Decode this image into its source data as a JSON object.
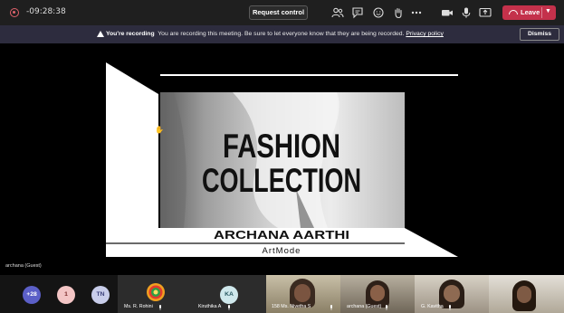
{
  "topbar": {
    "timer": "-09:28:38",
    "request_control": "Request control",
    "leave": "Leave"
  },
  "banner": {
    "bold": "You're recording",
    "text": "You are recording this meeting. Be sure to let everyone know that they are being recorded.",
    "link": "Privacy policy",
    "dismiss": "Dismiss"
  },
  "slide": {
    "title_line1": "FASHION",
    "title_line2": "COLLECTION",
    "name": "ARCHANA AARTHI",
    "brand": "ArtMode"
  },
  "presenter_caption": "archana (Guest)",
  "participants": {
    "more_count": "+28",
    "badge_1": "1",
    "tn": "TN",
    "rohini": "Ms. R. Rohini",
    "ka": "KA",
    "kiruthika": "Kiruthika A",
    "nivetha": "158 Ms. Nivetha S",
    "archana": "archana (Guest)",
    "kavitha": "G. Kavitha"
  },
  "colors": {
    "leave": "#c4314b",
    "banner": "#2d2c3e",
    "plus_avatar": "#5b5fc7",
    "one_avatar": "#f3c5c5",
    "tn_avatar": "#c8cdea",
    "ka_avatar": "#cfe8ec"
  }
}
